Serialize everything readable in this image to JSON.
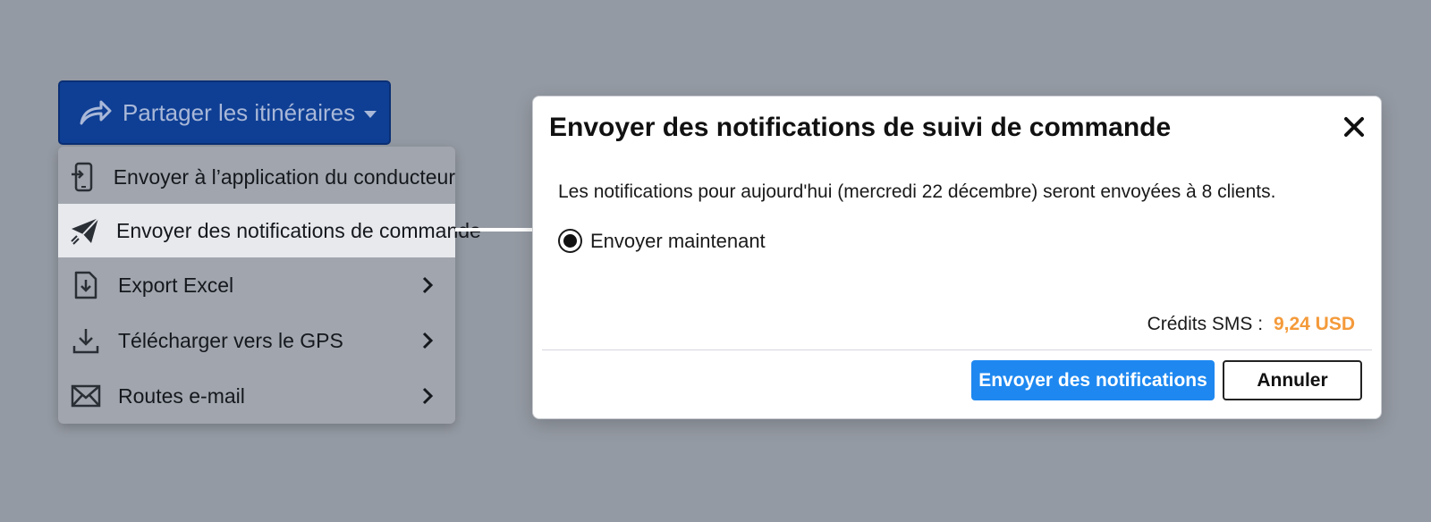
{
  "share_button": {
    "label": "Partager les itinéraires",
    "icon": "share-arrow-icon"
  },
  "menu": {
    "items": [
      {
        "label": "Envoyer à l’application du conducteur",
        "icon": "phone-send-icon",
        "has_submenu": false,
        "active": false
      },
      {
        "label": "Envoyer des notifications de commande",
        "icon": "paper-plane-icon",
        "has_submenu": false,
        "active": true
      },
      {
        "label": "Export Excel",
        "icon": "file-download-icon",
        "has_submenu": true,
        "active": false
      },
      {
        "label": "Télécharger vers le GPS",
        "icon": "download-icon",
        "has_submenu": true,
        "active": false
      },
      {
        "label": "Routes e-mail",
        "icon": "envelope-icon",
        "has_submenu": true,
        "active": false
      }
    ]
  },
  "dialog": {
    "title": "Envoyer des notifications de suivi de commande",
    "message": "Les notifications pour aujourd'hui (mercredi 22 décembre) seront envoyées à 8 clients.",
    "radio_option": {
      "label": "Envoyer maintenant",
      "selected": true
    },
    "credits_label": "Crédits SMS :",
    "credits_value": "9,24 USD",
    "primary_button": "Envoyer des notifications",
    "cancel_button": "Annuler"
  },
  "colors": {
    "background": "#949aa3",
    "share_button": "#0f3f94",
    "primary": "#1e88f0",
    "credits_accent": "#f49a3a"
  }
}
